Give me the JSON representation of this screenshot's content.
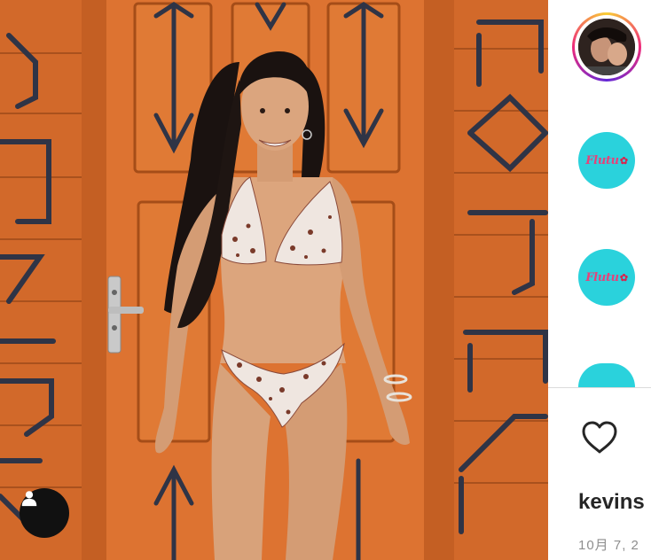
{
  "post": {
    "username": "kevins",
    "date": "10月 7, 2"
  },
  "story_avatar": {
    "icon": "profile-photo"
  },
  "suggestions": [
    {
      "logo_text": "Flutu",
      "logo_mark": "✿"
    },
    {
      "logo_text": "Flutu",
      "logo_mark": "✿"
    },
    {
      "logo_text": "",
      "logo_mark": ""
    }
  ],
  "actions": {
    "like_icon": "heart-outline-icon",
    "tag_icon": "user-tag-icon"
  },
  "colors": {
    "door_orange": "#d8702a",
    "door_dark": "#b85620",
    "paint_navy": "#2b3040",
    "brand_cyan": "#2ad2dc",
    "brand_pink": "#e6427a"
  }
}
